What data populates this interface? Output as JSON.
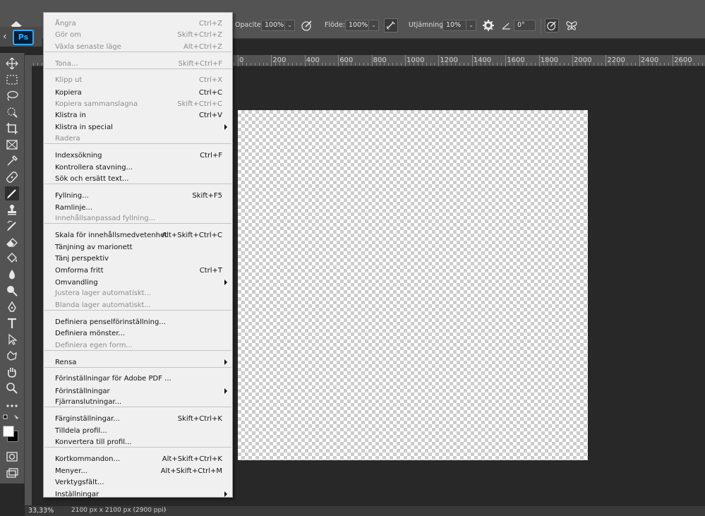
{
  "options_bar": {
    "opacity_label": "Opacitet:",
    "opacity_value": "100%",
    "flow_label": "Flöde:",
    "flow_value": "100%",
    "smoothing_label": "Utjämning:",
    "smoothing_value": "10%",
    "angle_value": "0°"
  },
  "app": {
    "logo": "Ps"
  },
  "ruler": {
    "labels": [
      "0",
      "200",
      "400",
      "600",
      "800",
      "1000",
      "1200",
      "1400",
      "1600",
      "1800",
      "2000",
      "2200",
      "2400",
      "2600"
    ]
  },
  "menu": {
    "items": [
      {
        "label": "Ångra",
        "shortcut": "Ctrl+Z",
        "disabled": true
      },
      {
        "label": "Gör om",
        "shortcut": "Skift+Ctrl+Z",
        "disabled": true
      },
      {
        "label": "Växla senaste läge",
        "shortcut": "Alt+Ctrl+Z",
        "disabled": true
      },
      {
        "label": "Tona...",
        "shortcut": "Skift+Ctrl+F",
        "disabled": true
      },
      {
        "label": "Klipp ut",
        "shortcut": "Ctrl+X",
        "disabled": true
      },
      {
        "label": "Kopiera",
        "shortcut": "Ctrl+C",
        "disabled": false
      },
      {
        "label": "Kopiera sammanslagna",
        "shortcut": "Skift+Ctrl+C",
        "disabled": true
      },
      {
        "label": "Klistra in",
        "shortcut": "Ctrl+V",
        "disabled": false
      },
      {
        "label": "Klistra in special",
        "shortcut": "",
        "disabled": false,
        "submenu": true
      },
      {
        "label": "Radera",
        "shortcut": "",
        "disabled": true
      },
      {
        "label": "Indexsökning",
        "shortcut": "Ctrl+F",
        "disabled": false
      },
      {
        "label": "Kontrollera stavning...",
        "shortcut": "",
        "disabled": false
      },
      {
        "label": "Sök och ersätt text...",
        "shortcut": "",
        "disabled": false
      },
      {
        "label": "Fyllning...",
        "shortcut": "Skift+F5",
        "disabled": false
      },
      {
        "label": "Ramlinje...",
        "shortcut": "",
        "disabled": false
      },
      {
        "label": "Innehållsanpassad fyllning...",
        "shortcut": "",
        "disabled": true
      },
      {
        "label": "Skala för innehållsmedvetenhet",
        "shortcut": "Alt+Skift+Ctrl+C",
        "disabled": false
      },
      {
        "label": "Tänjning av marionett",
        "shortcut": "",
        "disabled": false
      },
      {
        "label": "Tänj perspektiv",
        "shortcut": "",
        "disabled": false
      },
      {
        "label": "Omforma fritt",
        "shortcut": "Ctrl+T",
        "disabled": false
      },
      {
        "label": "Omvandling",
        "shortcut": "",
        "disabled": false,
        "submenu": true
      },
      {
        "label": "Justera lager automatiskt...",
        "shortcut": "",
        "disabled": true
      },
      {
        "label": "Blanda lager automatiskt...",
        "shortcut": "",
        "disabled": true
      },
      {
        "label": "Definiera penselförinställning...",
        "shortcut": "",
        "disabled": false
      },
      {
        "label": "Definiera mönster...",
        "shortcut": "",
        "disabled": false
      },
      {
        "label": "Definiera egen form...",
        "shortcut": "",
        "disabled": true
      },
      {
        "label": "Rensa",
        "shortcut": "",
        "disabled": false,
        "submenu": true
      },
      {
        "label": "Förinställningar för Adobe PDF ...",
        "shortcut": "",
        "disabled": false
      },
      {
        "label": "Förinställningar",
        "shortcut": "",
        "disabled": false,
        "submenu": true
      },
      {
        "label": "Fjärranslutningar...",
        "shortcut": "",
        "disabled": false
      },
      {
        "label": "Färginställningar...",
        "shortcut": "Skift+Ctrl+K",
        "disabled": false
      },
      {
        "label": "Tilldela profil...",
        "shortcut": "",
        "disabled": false
      },
      {
        "label": "Konvertera till profil...",
        "shortcut": "",
        "disabled": false
      },
      {
        "label": "Kortkommandon...",
        "shortcut": "Alt+Skift+Ctrl+K",
        "disabled": false
      },
      {
        "label": "Menyer...",
        "shortcut": "Alt+Skift+Ctrl+M",
        "disabled": false
      },
      {
        "label": "Verktygsfält...",
        "shortcut": "",
        "disabled": false
      },
      {
        "label": "Inställningar",
        "shortcut": "",
        "disabled": false,
        "submenu": true
      }
    ]
  },
  "status": {
    "zoom": "33,33%",
    "doc_info": "2100 px x 2100 px (2900 ppi)"
  },
  "colors": {
    "panel": "#535353",
    "workspace": "#282828",
    "menu_bg": "#f0f0f0",
    "accent": "#31a8ff"
  }
}
